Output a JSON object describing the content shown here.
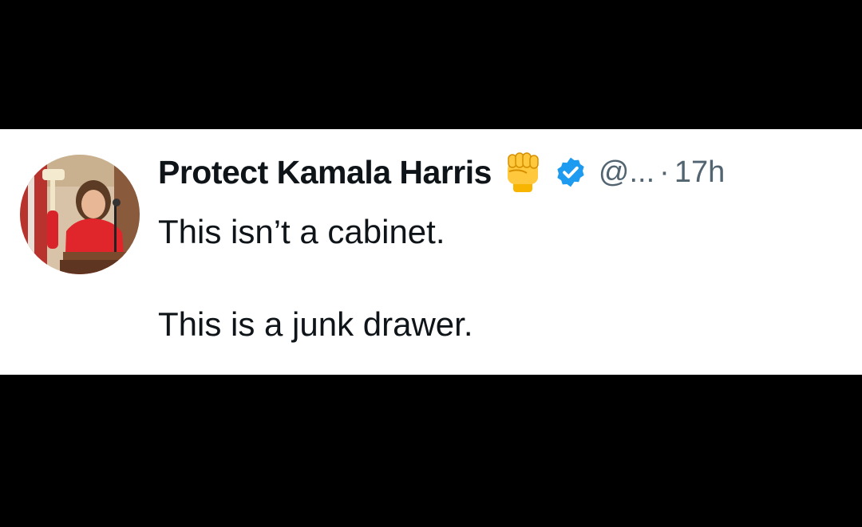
{
  "tweet": {
    "author": {
      "display_name": "Protect Kamala Harris",
      "emoji_icon": "raised-fist-icon",
      "verified": true,
      "verified_color": "#1d9bf0",
      "handle": "@...",
      "separator": "·",
      "timestamp": "17h"
    },
    "text_lines": [
      "This isn’t a cabinet.",
      "This is a junk drawer."
    ]
  },
  "colors": {
    "background": "#000000",
    "card": "#ffffff",
    "text": "#0f1419",
    "secondary_text": "#536471"
  }
}
